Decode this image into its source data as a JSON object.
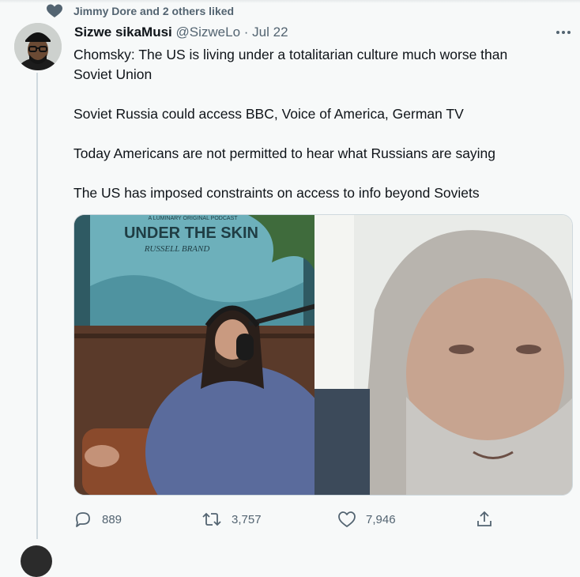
{
  "social_context": {
    "text": "Jimmy Dore and 2 others liked",
    "icon": "heart-icon"
  },
  "tweet": {
    "author_name": "Sizwe sikaMusi",
    "handle": "@SizweLo",
    "separator": "·",
    "date": "Jul 22",
    "lines": [
      "Chomsky: The US is living under a totalitarian culture much worse than",
      "Soviet Union",
      "",
      "Soviet Russia could access BBC, Voice of America, German TV",
      "",
      "Today Americans are not permitted to hear what Russians are saying",
      "",
      "The US has imposed constraints on access to info beyond Soviets"
    ],
    "media": {
      "podcast_tag": "A LUMINARY ORIGINAL PODCAST",
      "show_title": "UNDER THE SKIN",
      "host": "RUSSELL BRAND"
    },
    "actions": {
      "reply_count": "889",
      "retweet_count": "3,757",
      "like_count": "7,946"
    }
  },
  "colors": {
    "background": "#f7f9f9",
    "secondary_text": "#536471",
    "primary_text": "#0f1419",
    "thread_line": "#cfd9de"
  }
}
